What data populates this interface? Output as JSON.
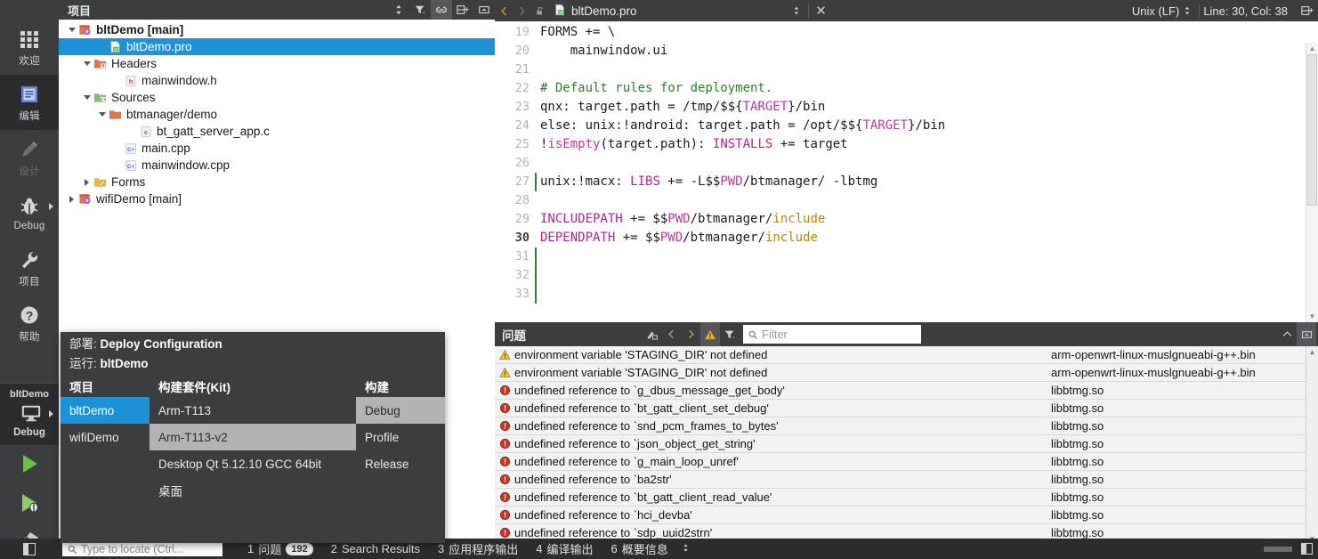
{
  "modebar": {
    "items": [
      {
        "label": "欢迎",
        "icon": "grid-icon",
        "state": "normal"
      },
      {
        "label": "编辑",
        "icon": "edit-document-icon",
        "state": "active"
      },
      {
        "label": "设计",
        "icon": "pencil-icon",
        "state": "disabled"
      },
      {
        "label": "Debug",
        "icon": "bug-icon",
        "state": "normal",
        "arrow": true
      },
      {
        "label": "项目",
        "icon": "wrench-icon",
        "state": "normal"
      },
      {
        "label": "帮助",
        "icon": "question-circle-icon",
        "state": "normal"
      }
    ],
    "run_selector": {
      "project": "bltDemo",
      "config": "Debug",
      "icon": "monitor-icon"
    },
    "run_buttons": [
      {
        "name": "run-button",
        "icon": "green-play-icon"
      },
      {
        "name": "debug-button",
        "icon": "play-bug-icon"
      },
      {
        "name": "build-button",
        "icon": "hammer-icon"
      }
    ]
  },
  "project_panel": {
    "title": "项目",
    "toolbar": [
      {
        "name": "sort-toggle",
        "icon": "up-down-arrows-icon",
        "active": false
      },
      {
        "name": "filter-button",
        "icon": "filter-icon",
        "active": false
      },
      {
        "name": "sync-with-editor-button",
        "icon": "link-icon",
        "active": true
      },
      {
        "name": "split-button",
        "icon": "split-add-icon",
        "active": false
      },
      {
        "name": "close-panel-button",
        "icon": "close-panel-icon",
        "active": false
      }
    ],
    "tree": [
      {
        "label": "bltDemo [main]",
        "depth": 0,
        "twist": "down",
        "icon": "qt-project-icon",
        "bold": true,
        "selected": false
      },
      {
        "label": "bltDemo.pro",
        "depth": 2,
        "twist": "none",
        "icon": "qt-pro-file-icon",
        "bold": false,
        "selected": true
      },
      {
        "label": "Headers",
        "depth": 1,
        "twist": "down",
        "icon": "headers-folder-icon",
        "bold": false,
        "selected": false
      },
      {
        "label": "mainwindow.h",
        "depth": 3,
        "twist": "none",
        "icon": "h-file-icon",
        "bold": false,
        "selected": false
      },
      {
        "label": "Sources",
        "depth": 1,
        "twist": "down",
        "icon": "sources-folder-icon",
        "bold": false,
        "selected": false
      },
      {
        "label": "btmanager/demo",
        "depth": 2,
        "twist": "down",
        "icon": "folder-icon",
        "bold": false,
        "selected": false
      },
      {
        "label": "bt_gatt_server_app.c",
        "depth": 4,
        "twist": "none",
        "icon": "c-file-icon",
        "bold": false,
        "selected": false
      },
      {
        "label": "main.cpp",
        "depth": 3,
        "twist": "none",
        "icon": "cpp-file-icon",
        "bold": false,
        "selected": false
      },
      {
        "label": "mainwindow.cpp",
        "depth": 3,
        "twist": "none",
        "icon": "cpp-file-icon",
        "bold": false,
        "selected": false
      },
      {
        "label": "Forms",
        "depth": 1,
        "twist": "right",
        "icon": "forms-folder-icon",
        "bold": false,
        "selected": false
      },
      {
        "label": "wifiDemo [main]",
        "depth": 0,
        "twist": "right",
        "icon": "qt-project-icon",
        "bold": false,
        "selected": false
      }
    ]
  },
  "deploy_popup": {
    "deploy_key": "部署:",
    "deploy_value": "Deploy Configuration",
    "run_key": "运行:",
    "run_value": "bltDemo",
    "col_headers": [
      "项目",
      "构建套件(Kit)",
      "构建"
    ],
    "projects": [
      {
        "label": "bltDemo",
        "selected": "blue"
      },
      {
        "label": "wifiDemo",
        "selected": "none"
      }
    ],
    "kits": [
      {
        "label": "Arm-T113",
        "selected": "none"
      },
      {
        "label": "Arm-T113-v2",
        "selected": "grey"
      },
      {
        "label": "Desktop Qt 5.12.10 GCC 64bit",
        "selected": "none"
      },
      {
        "label": "桌面",
        "selected": "none"
      }
    ],
    "builds": [
      {
        "label": "Debug",
        "selected": "grey"
      },
      {
        "label": "Profile",
        "selected": "none"
      },
      {
        "label": "Release",
        "selected": "none"
      }
    ]
  },
  "editor": {
    "back_icon": "chevron-left-icon",
    "forward_icon": "chevron-right-icon",
    "lock_icon": "unlocked-padlock-icon",
    "file_icon": "qt-pro-file-icon",
    "filename": "bltDemo.pro",
    "dropdown_icon": "up-down-arrows-icon",
    "close_label": "✕",
    "line_ending": "Unix (LF)",
    "line_ending_arrow_icon": "up-down-arrows-icon",
    "cursor_position": "Line: 30, Col: 38",
    "split_icon": "split-add-icon",
    "lines": [
      {
        "n": "19",
        "current": false,
        "tokens": [
          {
            "t": "FORMS += \\",
            "c": "kw-plain"
          }
        ]
      },
      {
        "n": "20",
        "current": false,
        "tokens": [
          {
            "t": "    mainwindow.ui",
            "c": "plain"
          }
        ]
      },
      {
        "n": "21",
        "current": false,
        "tokens": [
          {
            "t": "",
            "c": "plain"
          }
        ]
      },
      {
        "n": "22",
        "current": false,
        "tokens": [
          {
            "t": "# Default rules for deployment.",
            "c": "cm"
          }
        ]
      },
      {
        "n": "23",
        "current": false,
        "tokens": [
          {
            "t": "qnx: target.path = /tmp/$${",
            "c": "plain"
          },
          {
            "t": "TARGET",
            "c": "var"
          },
          {
            "t": "}/bin",
            "c": "plain"
          }
        ]
      },
      {
        "n": "24",
        "current": false,
        "tokens": [
          {
            "t": "else: unix:!android: target.path = /opt/$${",
            "c": "plain"
          },
          {
            "t": "TARGET",
            "c": "var"
          },
          {
            "t": "}/bin",
            "c": "plain"
          }
        ]
      },
      {
        "n": "25",
        "current": false,
        "tokens": [
          {
            "t": "!",
            "c": "plain"
          },
          {
            "t": "isEmpty",
            "c": "fn"
          },
          {
            "t": "(target.path): ",
            "c": "plain"
          },
          {
            "t": "INSTALLS",
            "c": "kw"
          },
          {
            "t": " += target",
            "c": "plain"
          }
        ]
      },
      {
        "n": "26",
        "current": false,
        "tokens": [
          {
            "t": "",
            "c": "plain"
          }
        ]
      },
      {
        "n": "27",
        "current": false,
        "marker": true,
        "tokens": [
          {
            "t": "unix:!macx: ",
            "c": "plain"
          },
          {
            "t": "LIBS",
            "c": "kw"
          },
          {
            "t": " += -L$$",
            "c": "plain"
          },
          {
            "t": "PWD",
            "c": "var"
          },
          {
            "t": "/btmanager/ -lbtmg",
            "c": "plain"
          }
        ]
      },
      {
        "n": "28",
        "current": false,
        "tokens": [
          {
            "t": "",
            "c": "plain"
          }
        ]
      },
      {
        "n": "29",
        "current": false,
        "tokens": [
          {
            "t": "INCLUDEPATH",
            "c": "kw"
          },
          {
            "t": " += $$",
            "c": "plain"
          },
          {
            "t": "PWD",
            "c": "var"
          },
          {
            "t": "/btmanager/",
            "c": "plain"
          },
          {
            "t": "include",
            "c": "str"
          }
        ]
      },
      {
        "n": "30",
        "current": true,
        "tokens": [
          {
            "t": "DEPENDPATH",
            "c": "kw"
          },
          {
            "t": " += $$",
            "c": "plain"
          },
          {
            "t": "PWD",
            "c": "var"
          },
          {
            "t": "/btmanager/",
            "c": "plain"
          },
          {
            "t": "include",
            "c": "str"
          }
        ]
      },
      {
        "n": "31",
        "current": false,
        "marker": true,
        "tokens": [
          {
            "t": "",
            "c": "plain"
          }
        ]
      },
      {
        "n": "32",
        "current": false,
        "marker": true,
        "tokens": [
          {
            "t": "",
            "c": "plain"
          }
        ]
      },
      {
        "n": "33",
        "current": false,
        "marker": true,
        "tokens": [
          {
            "t": "",
            "c": "plain"
          }
        ]
      }
    ]
  },
  "issues_panel": {
    "title": "问题",
    "toolbar": [
      {
        "name": "clear-button",
        "icon": "broom-icon",
        "active": false
      },
      {
        "name": "previous-issue-button",
        "icon": "chevron-left-icon",
        "active": false
      },
      {
        "name": "next-issue-button",
        "icon": "chevron-right-icon",
        "active": false
      },
      {
        "name": "show-warnings-toggle",
        "icon": "warning-triangle-icon",
        "active": true
      },
      {
        "name": "filter-button",
        "icon": "filter-icon",
        "active": false
      }
    ],
    "filter_placeholder": "Filter",
    "filter_value": "",
    "search_icon": "magnifier-icon",
    "collapse_icon": "chevron-up-icon",
    "maximize_icon": "maximize-panel-icon",
    "rows": [
      {
        "severity": "warning",
        "description": "environment variable 'STAGING_DIR' not defined",
        "file": "arm-openwrt-linux-muslgnueabi-g++.bin"
      },
      {
        "severity": "warning",
        "description": "environment variable 'STAGING_DIR' not defined",
        "file": "arm-openwrt-linux-muslgnueabi-g++.bin"
      },
      {
        "severity": "error",
        "description": "undefined reference to `g_dbus_message_get_body'",
        "file": "libbtmg.so"
      },
      {
        "severity": "error",
        "description": "undefined reference to `bt_gatt_client_set_debug'",
        "file": "libbtmg.so"
      },
      {
        "severity": "error",
        "description": "undefined reference to `snd_pcm_frames_to_bytes'",
        "file": "libbtmg.so"
      },
      {
        "severity": "error",
        "description": "undefined reference to `json_object_get_string'",
        "file": "libbtmg.so"
      },
      {
        "severity": "error",
        "description": "undefined reference to `g_main_loop_unref'",
        "file": "libbtmg.so"
      },
      {
        "severity": "error",
        "description": "undefined reference to `ba2str'",
        "file": "libbtmg.so"
      },
      {
        "severity": "error",
        "description": "undefined reference to `bt_gatt_client_read_value'",
        "file": "libbtmg.so"
      },
      {
        "severity": "error",
        "description": "undefined reference to `hci_devba'",
        "file": "libbtmg.so"
      },
      {
        "severity": "error",
        "description": "undefined reference to `sdp_uuid2strn'",
        "file": "libbtmg.so"
      }
    ]
  },
  "statusbar": {
    "sidebar_toggle_icon": "sidebar-toggle-icon",
    "locator_placeholder": "Type to locate (Ctrl...",
    "locator_search_icon": "magnifier-icon",
    "items": [
      {
        "num": "1",
        "label": "问题",
        "badge": "192"
      },
      {
        "num": "2",
        "label": "Search Results",
        "badge": ""
      },
      {
        "num": "3",
        "label": "应用程序输出",
        "badge": ""
      },
      {
        "num": "4",
        "label": "编译输出",
        "badge": ""
      },
      {
        "num": "6",
        "label": "概要信息",
        "badge": ""
      }
    ],
    "overflow_icon": "up-down-arrows-icon",
    "progress_icon": "progress-bar",
    "right_toggle_icon": "sidebar-toggle-icon"
  },
  "colors": {
    "chrome_dark": "#3b3d3f",
    "chrome_darker": "#2b2c2e",
    "selection_blue": "#1d92d8",
    "selection_grey": "#b3b3b3",
    "error_red": "#c0392b",
    "warning_yellow": "#e8b33a",
    "keyword_magenta": "#b5238f",
    "comment_green": "#308030",
    "string_olive": "#b8860b",
    "issues_bg": "#f2f2f2"
  }
}
